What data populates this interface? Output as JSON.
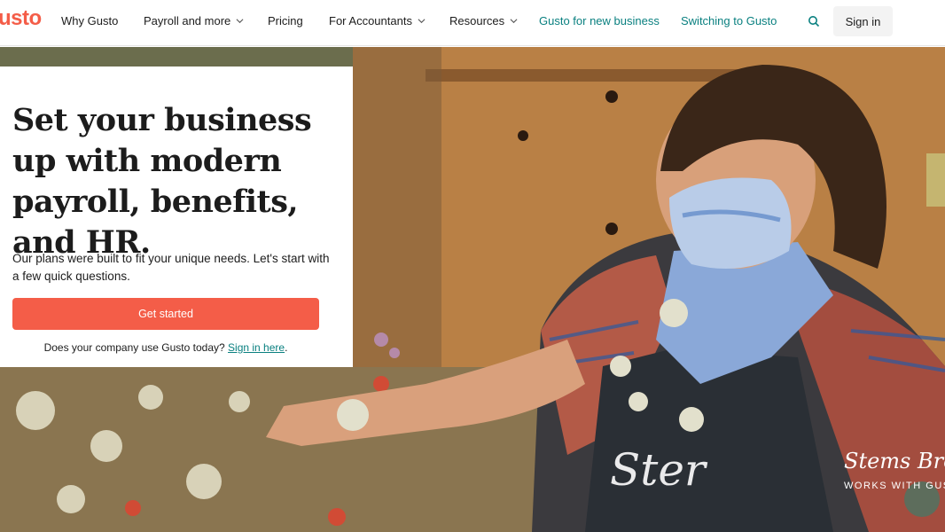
{
  "nav": {
    "logo": "usto",
    "items": [
      {
        "label": "Why Gusto"
      },
      {
        "label": "Payroll and more"
      },
      {
        "label": "Pricing"
      },
      {
        "label": "For Accountants"
      },
      {
        "label": "Resources"
      },
      {
        "label": "Gusto for new business"
      },
      {
        "label": "Switching to Gusto"
      }
    ],
    "signin_label": "Sign in"
  },
  "hero": {
    "headline": "Set your business up with modern payroll, benefits, and HR.",
    "subtext": "Our plans were built to fit your unique needs. Let's start with a few quick questions.",
    "cta_label": "Get started",
    "existing_prefix": "Does your company use Gusto today?",
    "existing_link": "Sign in here",
    "existing_suffix": ".",
    "sign_text": "Ster",
    "caption_name": "Stems Brook",
    "caption_sub": "WORKS WITH GUS"
  },
  "colors": {
    "accent": "#f45d48",
    "teal": "#0a8080"
  }
}
